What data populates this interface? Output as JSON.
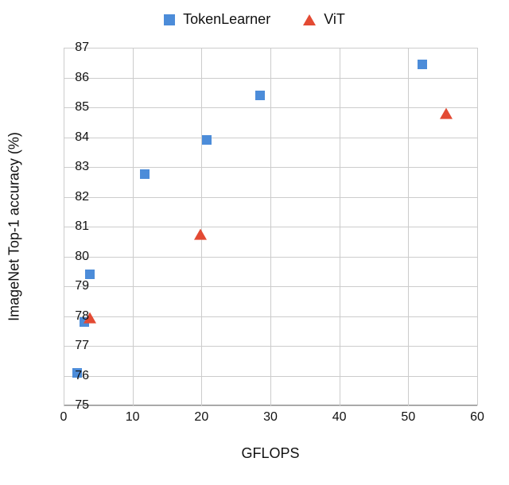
{
  "chart_data": {
    "type": "scatter",
    "title": "",
    "xlabel": "GFLOPS",
    "ylabel": "ImageNet Top-1 accuracy (%)",
    "xlim": [
      0,
      60
    ],
    "ylim": [
      75,
      87
    ],
    "xticks": [
      0,
      10,
      20,
      30,
      40,
      50,
      60
    ],
    "yticks": [
      75,
      76,
      77,
      78,
      79,
      80,
      81,
      82,
      83,
      84,
      85,
      86,
      87
    ],
    "series": [
      {
        "name": "TokenLearner",
        "marker": "square",
        "color": "#4C8CD9",
        "points": [
          {
            "x": 2.0,
            "y": 76.1
          },
          {
            "x": 3.0,
            "y": 77.8
          },
          {
            "x": 3.8,
            "y": 79.4
          },
          {
            "x": 11.8,
            "y": 82.75
          },
          {
            "x": 20.8,
            "y": 83.9
          },
          {
            "x": 28.5,
            "y": 85.4
          },
          {
            "x": 52.0,
            "y": 86.45
          }
        ]
      },
      {
        "name": "ViT",
        "marker": "triangle",
        "color": "#E34A33",
        "points": [
          {
            "x": 3.8,
            "y": 77.9
          },
          {
            "x": 19.8,
            "y": 80.7
          },
          {
            "x": 55.5,
            "y": 84.75
          }
        ]
      }
    ],
    "legend_position": "top"
  }
}
